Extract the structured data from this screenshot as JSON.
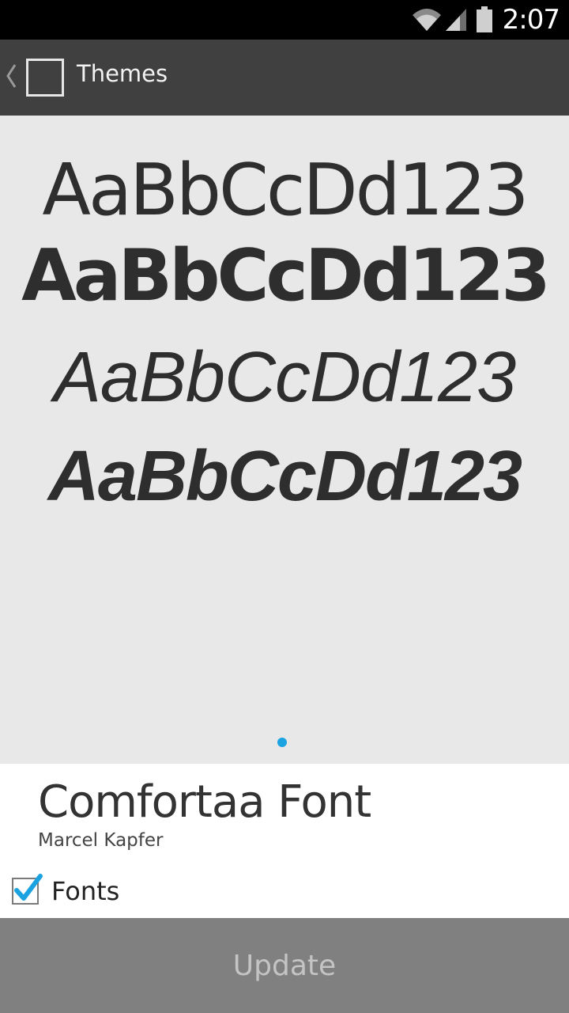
{
  "status_bar": {
    "time": "2:07",
    "icons": [
      "wifi-icon",
      "signal-icon",
      "battery-icon"
    ]
  },
  "action_bar": {
    "title": "Themes",
    "icons": [
      "back-chevron-icon",
      "app-icon"
    ]
  },
  "preview": {
    "samples": [
      "AaBbCcDd123",
      "AaBbCcDd123",
      "AaBbCcDd123",
      "AaBbCcDd123"
    ],
    "page_indicator": {
      "count": 1,
      "active": 1
    }
  },
  "theme": {
    "name": "Comfortaa Font",
    "author": "Marcel Kapfer"
  },
  "components": {
    "fonts_label": "Fonts",
    "fonts_checked": true
  },
  "footer": {
    "update_label": "Update"
  },
  "colors": {
    "status_bar": "#000000",
    "action_bar": "#404040",
    "preview_bg": "#e8e8e8",
    "accent": "#1aa3e0",
    "update_bar": "#808080"
  }
}
